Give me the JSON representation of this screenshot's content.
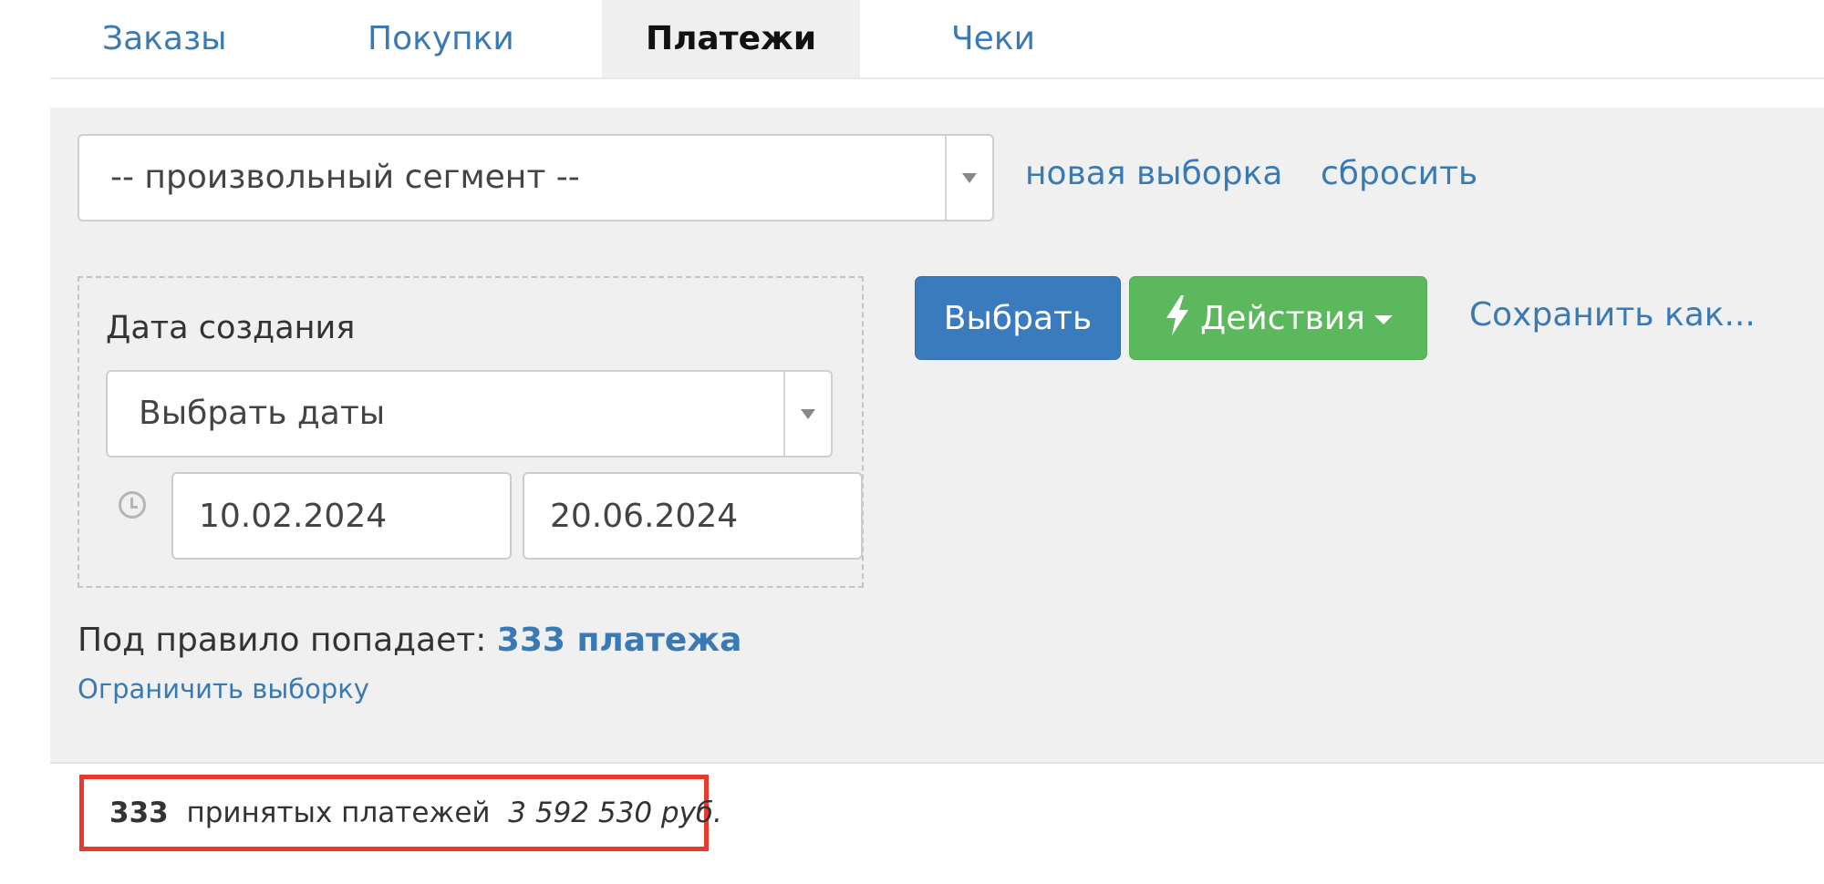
{
  "tabs": [
    {
      "label": "Заказы"
    },
    {
      "label": "Покупки"
    },
    {
      "label": "Платежи",
      "active": true
    },
    {
      "label": "Чеки"
    }
  ],
  "filter": {
    "segment_select": {
      "value": "-- произвольный сегмент --"
    },
    "new_selection_link": "новая выборка",
    "reset_link": "сбросить",
    "rule": {
      "label": "Дата создания",
      "period_select": {
        "value": "Выбрать даты"
      },
      "date_from": "10.02.2024",
      "date_to": "20.06.2024"
    },
    "select_button": "Выбрать",
    "actions_button": "Действия",
    "save_as_link": "Сохранить как...",
    "match_prefix": "Под правило попадает:",
    "match_count": "333 платежа",
    "limit_link": "Ограничить выборку"
  },
  "summary": {
    "count": "333",
    "label": "принятых платежей",
    "amount": "3 592 530 руб."
  },
  "colors": {
    "link": "#3a7ab4",
    "primary_button": "#3a7bbd",
    "success_button": "#5cb85c",
    "panel_bg": "#f0f0f0",
    "highlight_border": "#e8392b"
  },
  "icons": {
    "select_arrow": "triangle-down-icon",
    "clock": "clock-icon",
    "actions": "lightning-bolt-icon",
    "actions_caret": "caret-down-icon"
  }
}
